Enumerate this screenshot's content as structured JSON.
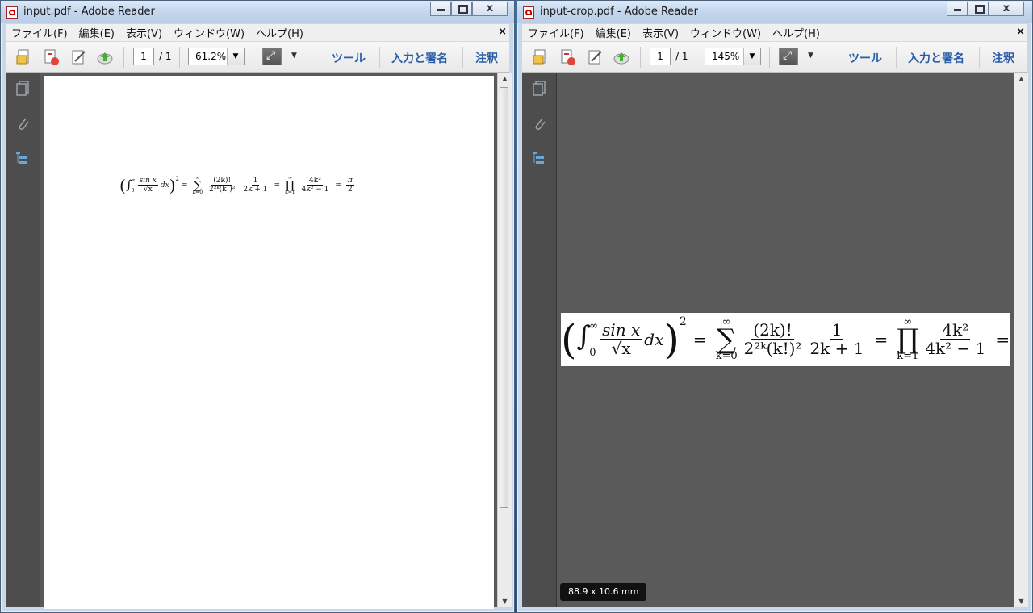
{
  "windows": [
    {
      "title": "input.pdf - Adobe Reader",
      "menu": [
        "ファイル(F)",
        "編集(E)",
        "表示(V)",
        "ウィンドウ(W)",
        "ヘルプ(H)"
      ],
      "page_current": "1",
      "page_total": "/ 1",
      "zoom": "61.2%",
      "tools_label": "ツール",
      "sign_label": "入力と署名",
      "comment_label": "注釈"
    },
    {
      "title": "input-crop.pdf - Adobe Reader",
      "menu": [
        "ファイル(F)",
        "編集(E)",
        "表示(V)",
        "ウィンドウ(W)",
        "ヘルプ(H)"
      ],
      "page_current": "1",
      "page_total": "/ 1",
      "zoom": "145%",
      "tools_label": "ツール",
      "sign_label": "入力と署名",
      "comment_label": "注釈"
    }
  ],
  "menu_close": "×",
  "caption_close": "x",
  "formula": {
    "sin_x": "sin x",
    "sqrt_x": "√x",
    "dx": "dx",
    "lower0": "0",
    "inf": "∞",
    "sum_lower": "k=0",
    "prod_lower": "k=1",
    "frac1_num": "(2k)!",
    "frac1_den": "2²ᵏ(k!)²",
    "frac2_num": "1",
    "frac2_den": "2k + 1",
    "frac3_num": "4k²",
    "frac3_den": "4k² − 1",
    "pi": "π",
    "two": "2",
    "eq": "="
  },
  "status_tip": "88.9 x 10.6 mm",
  "icons": [
    "file-open-icon",
    "create-pdf-icon",
    "edit-icon",
    "cloud-upload-icon",
    "fit-page-icon",
    "pages-panel-icon",
    "attachment-icon",
    "bookmarks-icon"
  ]
}
